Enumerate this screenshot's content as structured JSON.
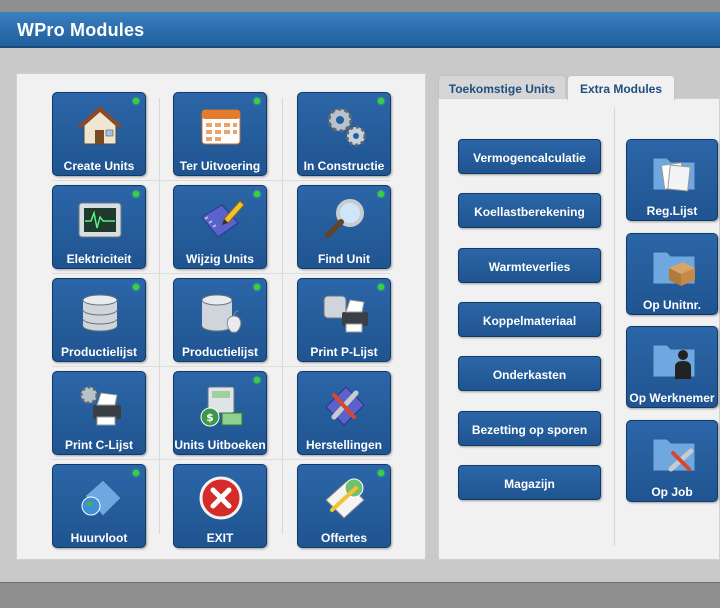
{
  "window": {
    "title": "WPro Modules"
  },
  "left_tiles": [
    {
      "label": "Create Units",
      "icon": "house-icon"
    },
    {
      "label": "Ter Uitvoering",
      "icon": "calendar-icon"
    },
    {
      "label": "In Constructie",
      "icon": "gears-icon"
    },
    {
      "label": "Elektriciteit",
      "icon": "oscilloscope-icon"
    },
    {
      "label": "Wijzig Units",
      "icon": "pencil-notebook-icon"
    },
    {
      "label": "Find Unit",
      "icon": "magnifier-icon"
    },
    {
      "label": "Productielijst",
      "icon": "database-icon"
    },
    {
      "label": "Productielijst",
      "icon": "database-apple-icon"
    },
    {
      "label": "Print P-Lijst",
      "icon": "printer-icon"
    },
    {
      "label": "Print C-Lijst",
      "icon": "printer-gears-icon"
    },
    {
      "label": "Units Uitboeken",
      "icon": "cash-register-icon"
    },
    {
      "label": "Herstellingen",
      "icon": "tools-icon"
    },
    {
      "label": "Huurvloot",
      "icon": "folder-globe-icon"
    },
    {
      "label": "EXIT",
      "icon": "close-icon"
    },
    {
      "label": "Offertes",
      "icon": "document-pen-icon"
    }
  ],
  "tabs": {
    "inactive": "Toekomstige Units",
    "active": "Extra Modules"
  },
  "extra_buttons": [
    "Vermogencalculatie",
    "Koellastberekening",
    "Warmteverlies",
    "Koppelmateriaal",
    "Onderkasten",
    "Bezetting op sporen",
    "Magazijn"
  ],
  "folder_tiles": [
    {
      "label": "Reg.Lijst",
      "icon": "folder-documents-icon"
    },
    {
      "label": "Op Unitnr.",
      "icon": "folder-box-icon"
    },
    {
      "label": "Op Werknemer",
      "icon": "folder-person-icon"
    },
    {
      "label": "Op Job",
      "icon": "folder-tools-icon"
    }
  ],
  "colors": {
    "tile_blue": "#2560a0",
    "status_green": "#35d335",
    "title_bar": "#2a6cad"
  }
}
